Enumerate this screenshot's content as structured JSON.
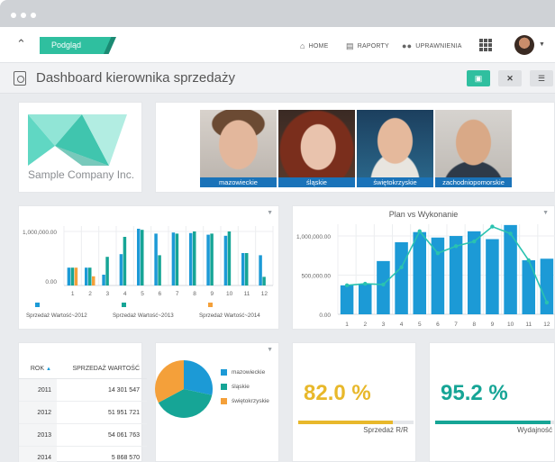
{
  "nav": {
    "active_tab": "Podgląd",
    "links": [
      {
        "label": "HOME",
        "icon": "home-icon"
      },
      {
        "label": "RAPORTY",
        "icon": "book-icon"
      },
      {
        "label": "UPRAWNIENIA",
        "icon": "users-icon"
      }
    ]
  },
  "header": {
    "title": "Dashboard kierownika sprzedaży",
    "buttons": [
      "save-icon",
      "close-icon",
      "menu-icon"
    ],
    "accent": "#2fbf9f"
  },
  "logo": {
    "company": "Sample Company Inc."
  },
  "people": [
    {
      "label": "mazowieckie"
    },
    {
      "label": "śląskie"
    },
    {
      "label": "świętokrzyskie"
    },
    {
      "label": "zachodniopomorskie"
    }
  ],
  "table": {
    "headers": {
      "year": "ROK",
      "value": "SPRZEDAŻ WARTOŚĆ"
    },
    "rows": [
      {
        "year": "2011",
        "value": "14 301 547"
      },
      {
        "year": "2012",
        "value": "51 951 721"
      },
      {
        "year": "2013",
        "value": "54 061 763"
      },
      {
        "year": "2014",
        "value": "5 868 570"
      }
    ]
  },
  "pie": {
    "legend": [
      {
        "label": "mazowieckie",
        "color": "#1c9ad6"
      },
      {
        "label": "śląskie",
        "color": "#16a596"
      },
      {
        "label": "świętokrzyskie",
        "color": "#f4a03a"
      }
    ]
  },
  "kpis": [
    {
      "value": "82.0 %",
      "label": "Sprzedaż R/R",
      "color": "#e8b82b",
      "fill": 0.82
    },
    {
      "value": "95.2 %",
      "label": "Wydajność",
      "color": "#16a596",
      "fill": 0.952
    }
  ],
  "chart_data": [
    {
      "type": "bar",
      "categories": [
        "1",
        "2",
        "3",
        "4",
        "5",
        "6",
        "7",
        "8",
        "9",
        "10",
        "11",
        "12"
      ],
      "ylim": [
        0,
        1100000
      ],
      "ytick_labels": [
        "1,000,000.00",
        "0.00"
      ],
      "series": [
        {
          "name": "Sprzedaż Wartość~2012",
          "color": "#1c9ad6",
          "values": [
            330000,
            330000,
            200000,
            580000,
            1050000,
            960000,
            980000,
            970000,
            940000,
            920000,
            600000,
            560000
          ]
        },
        {
          "name": "Sprzedaż Wartość~2013",
          "color": "#16a596",
          "values": [
            330000,
            330000,
            530000,
            900000,
            1030000,
            560000,
            960000,
            1000000,
            960000,
            1000000,
            600000,
            160000
          ]
        },
        {
          "name": "Sprzedaż Wartość~2014",
          "color": "#f4a03a",
          "values": [
            330000,
            170000,
            0,
            0,
            0,
            0,
            0,
            0,
            0,
            0,
            0,
            0
          ]
        }
      ],
      "grid": true,
      "legend": "bottom"
    },
    {
      "type": "bar",
      "title": "Plan vs Wykonanie",
      "categories": [
        "1",
        "2",
        "3",
        "4",
        "5",
        "6",
        "7",
        "8",
        "9",
        "10",
        "11",
        "12"
      ],
      "ylim": [
        0,
        1150000
      ],
      "ytick_labels": [
        "1,000,000.00",
        "500,000.00",
        "0.00"
      ],
      "series": [
        {
          "type": "bar",
          "color": "#1c9ad6",
          "values": [
            370000,
            380000,
            680000,
            920000,
            1050000,
            980000,
            1000000,
            1060000,
            960000,
            1140000,
            690000,
            710000
          ]
        },
        {
          "type": "line",
          "color": "#2ac2b0",
          "values": [
            370000,
            390000,
            380000,
            600000,
            1060000,
            780000,
            870000,
            930000,
            1120000,
            1030000,
            690000,
            150000
          ]
        }
      ],
      "grid": true
    }
  ]
}
